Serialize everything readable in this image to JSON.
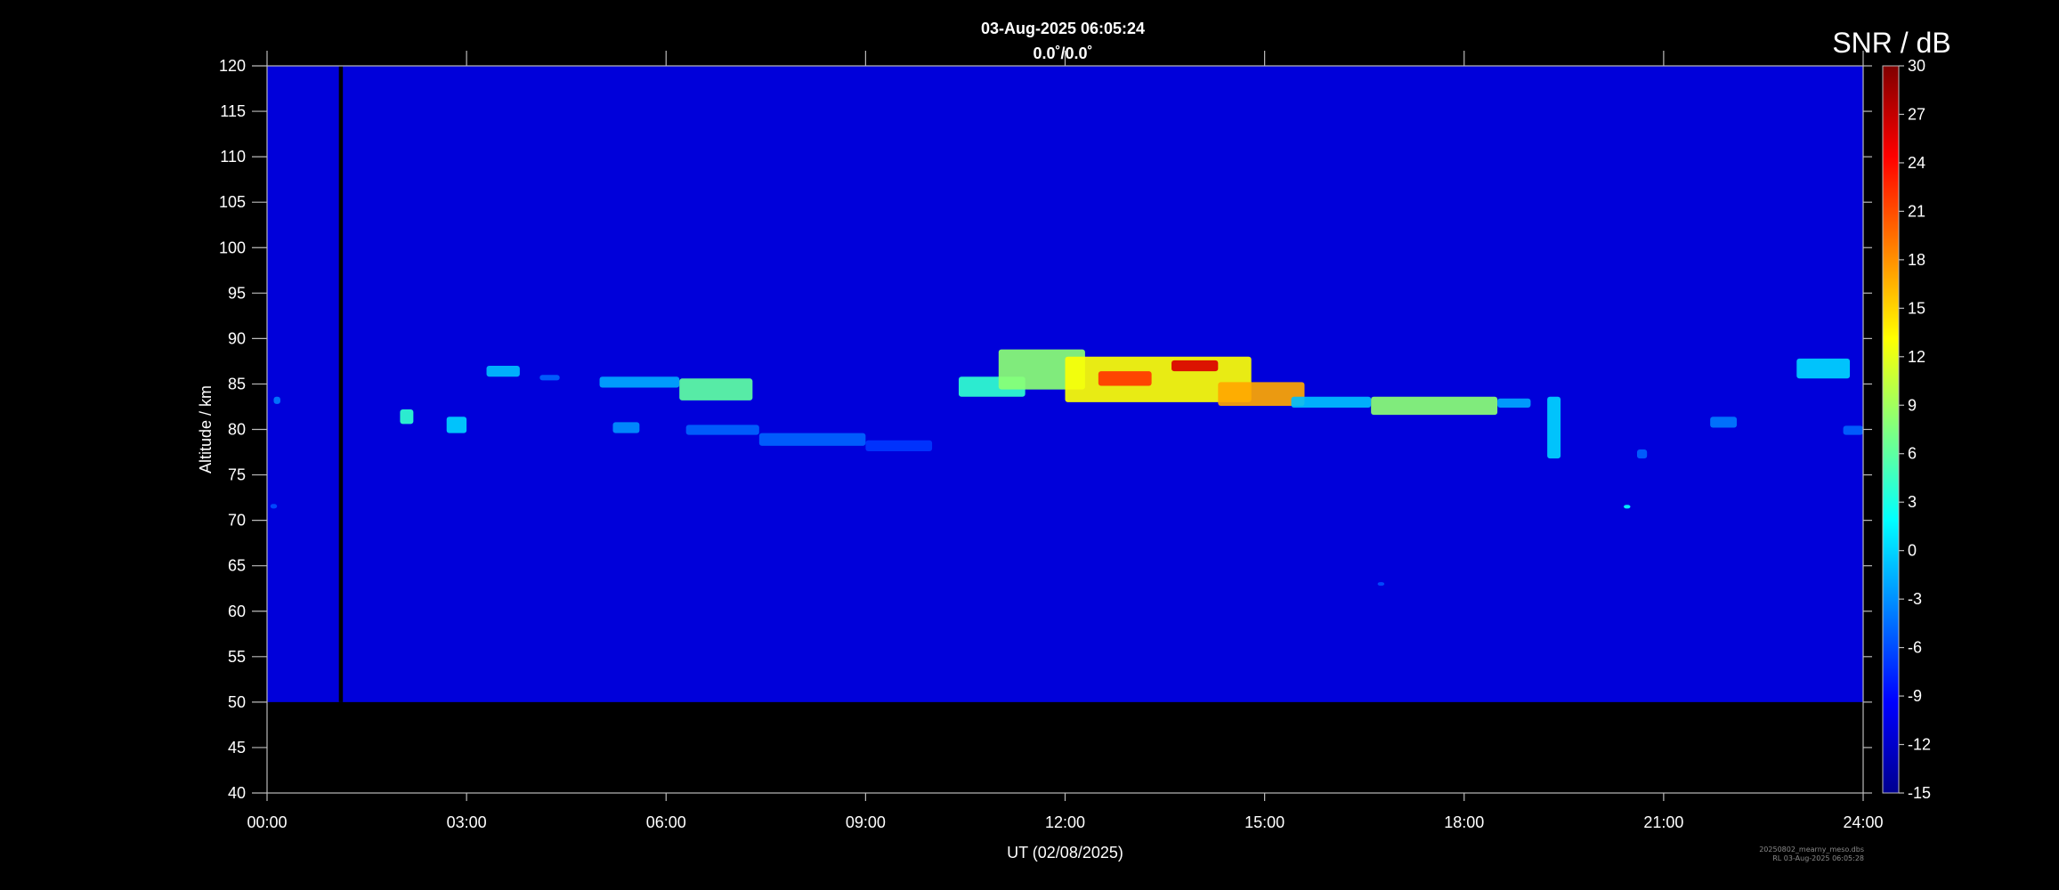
{
  "chart_data": {
    "type": "heatmap",
    "title": "03-Aug-2025 06:05:24",
    "subtitle": "0.0˚/0.0˚",
    "xlabel": "UT (02/08/2025)",
    "ylabel": "Altitude / km",
    "colorbar_label": "SNR / dB",
    "x_ticks": [
      "00:00",
      "03:00",
      "06:00",
      "09:00",
      "12:00",
      "15:00",
      "18:00",
      "21:00",
      "24:00"
    ],
    "xlim_hours": [
      0,
      24
    ],
    "y_ticks": [
      "40",
      "45",
      "50",
      "55",
      "60",
      "65",
      "70",
      "75",
      "80",
      "85",
      "90",
      "95",
      "100",
      "105",
      "110",
      "115",
      "120"
    ],
    "ylim_km": [
      40,
      120
    ],
    "colorbar_ticks": [
      "-15",
      "-12",
      "-9",
      "-6",
      "-3",
      "0",
      "3",
      "6",
      "9",
      "12",
      "15",
      "18",
      "21",
      "24",
      "27",
      "30"
    ],
    "clim_db": [
      -15,
      30
    ],
    "data_altitude_range_km": [
      50,
      120
    ],
    "background_snr_db": -11,
    "data_gap_hours": [
      1.08,
      1.14
    ],
    "echo_regions": [
      {
        "t_start": 0.1,
        "t_end": 0.2,
        "alt_bottom": 82.8,
        "alt_top": 83.6,
        "snr_db": -4
      },
      {
        "t_start": 0.05,
        "t_end": 0.15,
        "alt_bottom": 71.3,
        "alt_top": 71.8,
        "snr_db": -6
      },
      {
        "t_start": 2.0,
        "t_end": 2.2,
        "alt_bottom": 80.6,
        "alt_top": 82.2,
        "snr_db": 4
      },
      {
        "t_start": 2.7,
        "t_end": 3.0,
        "alt_bottom": 79.6,
        "alt_top": 81.4,
        "snr_db": 0
      },
      {
        "t_start": 3.3,
        "t_end": 3.8,
        "alt_bottom": 85.8,
        "alt_top": 87.0,
        "snr_db": -1
      },
      {
        "t_start": 4.1,
        "t_end": 4.4,
        "alt_bottom": 85.4,
        "alt_top": 86.0,
        "snr_db": -5
      },
      {
        "t_start": 5.0,
        "t_end": 6.2,
        "alt_bottom": 84.6,
        "alt_top": 85.8,
        "snr_db": -2
      },
      {
        "t_start": 6.2,
        "t_end": 7.3,
        "alt_bottom": 83.2,
        "alt_top": 85.6,
        "snr_db": 6
      },
      {
        "t_start": 5.2,
        "t_end": 5.6,
        "alt_bottom": 79.6,
        "alt_top": 80.8,
        "snr_db": -3
      },
      {
        "t_start": 6.3,
        "t_end": 7.4,
        "alt_bottom": 79.4,
        "alt_top": 80.5,
        "snr_db": -5
      },
      {
        "t_start": 7.4,
        "t_end": 9.0,
        "alt_bottom": 78.2,
        "alt_top": 79.6,
        "snr_db": -5
      },
      {
        "t_start": 9.0,
        "t_end": 10.0,
        "alt_bottom": 77.6,
        "alt_top": 78.8,
        "snr_db": -7
      },
      {
        "t_start": 10.4,
        "t_end": 11.4,
        "alt_bottom": 83.6,
        "alt_top": 85.8,
        "snr_db": 4
      },
      {
        "t_start": 11.0,
        "t_end": 12.3,
        "alt_bottom": 84.4,
        "alt_top": 88.8,
        "snr_db": 8
      },
      {
        "t_start": 12.0,
        "t_end": 14.8,
        "alt_bottom": 83.0,
        "alt_top": 88.0,
        "snr_db": 13
      },
      {
        "t_start": 13.6,
        "t_end": 14.3,
        "alt_bottom": 86.4,
        "alt_top": 87.6,
        "snr_db": 26
      },
      {
        "t_start": 12.5,
        "t_end": 13.3,
        "alt_bottom": 84.8,
        "alt_top": 86.4,
        "snr_db": 22
      },
      {
        "t_start": 14.3,
        "t_end": 15.6,
        "alt_bottom": 82.6,
        "alt_top": 85.2,
        "snr_db": 17
      },
      {
        "t_start": 15.4,
        "t_end": 16.6,
        "alt_bottom": 82.4,
        "alt_top": 83.6,
        "snr_db": -1
      },
      {
        "t_start": 16.6,
        "t_end": 18.5,
        "alt_bottom": 81.6,
        "alt_top": 83.6,
        "snr_db": 8
      },
      {
        "t_start": 18.5,
        "t_end": 19.0,
        "alt_bottom": 82.4,
        "alt_top": 83.4,
        "snr_db": -2
      },
      {
        "t_start": 19.25,
        "t_end": 19.45,
        "alt_bottom": 76.8,
        "alt_top": 83.6,
        "snr_db": 0
      },
      {
        "t_start": 20.6,
        "t_end": 20.75,
        "alt_bottom": 76.8,
        "alt_top": 77.8,
        "snr_db": -5
      },
      {
        "t_start": 20.4,
        "t_end": 20.5,
        "alt_bottom": 71.3,
        "alt_top": 71.7,
        "snr_db": 2
      },
      {
        "t_start": 21.7,
        "t_end": 22.1,
        "alt_bottom": 80.2,
        "alt_top": 81.4,
        "snr_db": -4
      },
      {
        "t_start": 23.0,
        "t_end": 23.8,
        "alt_bottom": 85.6,
        "alt_top": 87.8,
        "snr_db": 0
      },
      {
        "t_start": 23.7,
        "t_end": 24.0,
        "alt_bottom": 79.4,
        "alt_top": 80.4,
        "snr_db": -5
      },
      {
        "t_start": 16.7,
        "t_end": 16.8,
        "alt_bottom": 62.8,
        "alt_top": 63.2,
        "snr_db": -6
      }
    ]
  },
  "footer": {
    "line1": "20250802_mearny_meso.dbs",
    "line2": "RL 03-Aug-2025 06:05:28"
  }
}
